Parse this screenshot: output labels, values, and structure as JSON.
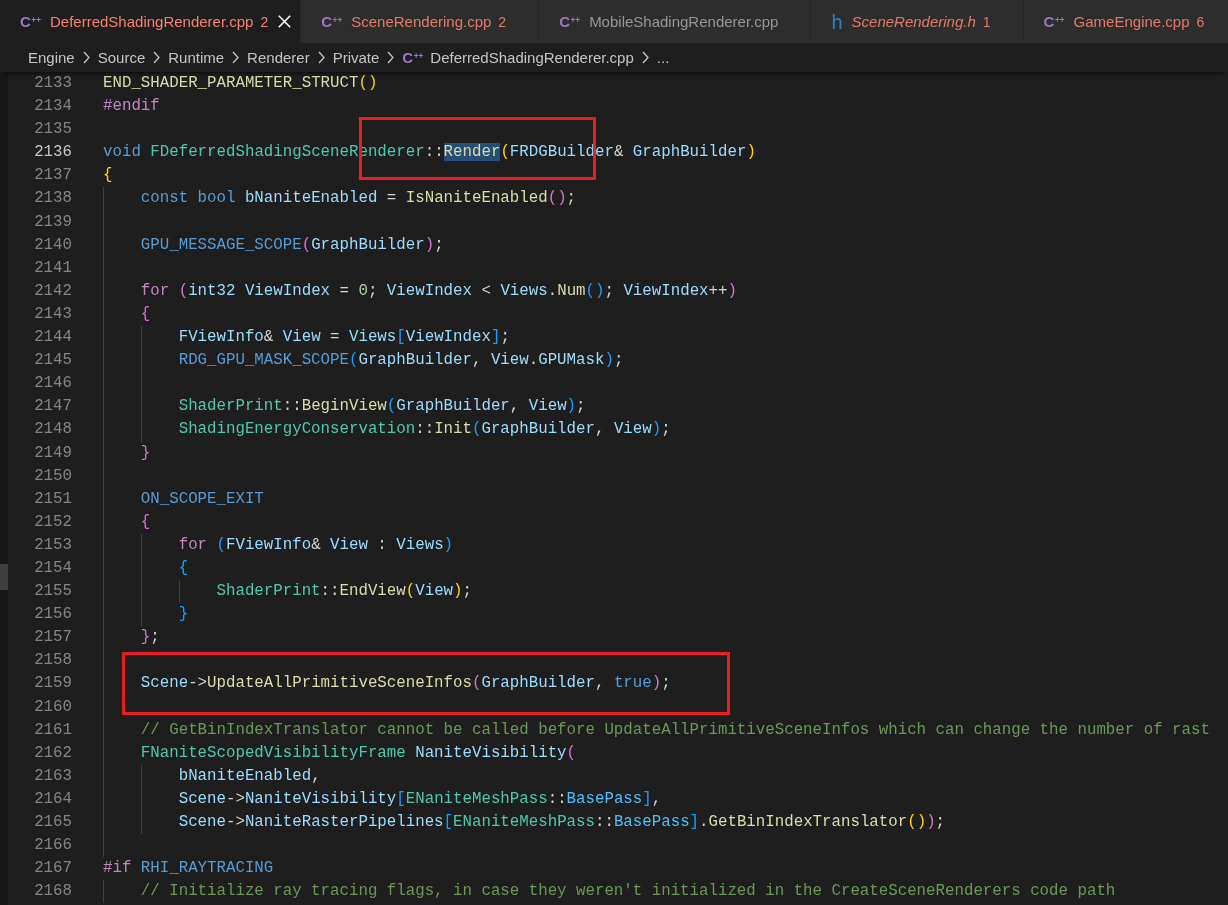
{
  "tabs": [
    {
      "icon": {
        "kind": "cpp",
        "glyph": "C$^{++}$"
      },
      "label": "DeferredShadingRenderer.cpp",
      "problems": "2",
      "selected": true,
      "preview": false
    },
    {
      "icon": {
        "kind": "cpp",
        "glyph": "C$^{++}$"
      },
      "label": "SceneRendering.cpp",
      "problems": "2",
      "selected": false,
      "preview": false
    },
    {
      "icon": {
        "kind": "cpp",
        "glyph": "C$^{++}$"
      },
      "label": "MobileShadingRenderer.cpp",
      "selected": false,
      "preview": false
    },
    {
      "icon": {
        "kind": "h",
        "glyph": "h"
      },
      "label": "SceneRendering.h",
      "problems": "1",
      "selected": false,
      "preview": true
    },
    {
      "icon": {
        "kind": "cpp",
        "glyph": "C$^{++}$"
      },
      "label": "GameEngine.cpp",
      "problems": "6",
      "selected": false,
      "preview": false
    }
  ],
  "breadcrumb": [
    {
      "label": "Engine"
    },
    {
      "label": "Source"
    },
    {
      "label": "Runtime"
    },
    {
      "label": "Renderer"
    },
    {
      "label": "Private"
    },
    {
      "icon": {
        "kind": "cpp",
        "glyph": "C$^{++}$"
      },
      "label": "DeferredShadingRenderer.cpp"
    },
    {
      "label": "..."
    }
  ],
  "editor": {
    "lines": [
      {
        "number": "2133",
        "current": false,
        "tokens": [
          {
            "kind": "function",
            "text": "END_SHADER_PARAMETER_STRUCT"
          },
          {
            "kind": "bracket1",
            "text": "()"
          }
        ]
      },
      {
        "number": "2134",
        "current": false,
        "tokens": [
          {
            "kind": "control",
            "text": "#endif"
          }
        ]
      },
      {
        "number": "2135",
        "current": false
      },
      {
        "number": "2136",
        "current": true,
        "tokens": [
          {
            "kind": "keyword",
            "text": "void "
          },
          {
            "kind": "type",
            "text": "FDeferredShadingSceneRenderer"
          },
          {
            "kind": "plain",
            "text": "::"
          },
          {
            "kind": "function",
            "text": "Render",
            "highlighted": true
          },
          {
            "kind": "bracket1",
            "text": "("
          },
          {
            "kind": "alias",
            "text": "FRDGBuilder"
          },
          {
            "kind": "plain",
            "text": "& "
          },
          {
            "kind": "variable",
            "text": "GraphBuilder"
          },
          {
            "kind": "bracket1",
            "text": ")"
          }
        ]
      },
      {
        "number": "2137",
        "current": false,
        "tokens": [
          {
            "kind": "bracket1",
            "text": "{"
          }
        ]
      },
      {
        "number": "2138",
        "current": false,
        "tokens": [
          {
            "kind": "keyword",
            "text": "    const bool "
          },
          {
            "kind": "variable",
            "text": "bNaniteEnabled"
          },
          {
            "kind": "plain",
            "text": " = "
          },
          {
            "kind": "function",
            "text": "IsNaniteEnabled"
          },
          {
            "kind": "bracket2",
            "text": "()"
          },
          {
            "kind": "plain",
            "text": ";"
          }
        ]
      },
      {
        "number": "2139",
        "current": false
      },
      {
        "number": "2140",
        "current": false,
        "tokens": [
          {
            "kind": "macro",
            "text": "    GPU_MESSAGE_SCOPE"
          },
          {
            "kind": "bracket2",
            "text": "("
          },
          {
            "kind": "variable",
            "text": "GraphBuilder"
          },
          {
            "kind": "bracket2",
            "text": ")"
          },
          {
            "kind": "plain",
            "text": ";"
          }
        ]
      },
      {
        "number": "2141",
        "current": false
      },
      {
        "number": "2142",
        "current": false,
        "tokens": [
          {
            "kind": "control",
            "text": "    for "
          },
          {
            "kind": "bracket2",
            "text": "("
          },
          {
            "kind": "alias",
            "text": "int32 "
          },
          {
            "kind": "variable",
            "text": "ViewIndex"
          },
          {
            "kind": "plain",
            "text": " = "
          },
          {
            "kind": "number",
            "text": "0"
          },
          {
            "kind": "plain",
            "text": "; "
          },
          {
            "kind": "variable",
            "text": "ViewIndex"
          },
          {
            "kind": "plain",
            "text": " < "
          },
          {
            "kind": "variable",
            "text": "Views"
          },
          {
            "kind": "plain",
            "text": "."
          },
          {
            "kind": "function",
            "text": "Num"
          },
          {
            "kind": "bracket3",
            "text": "()"
          },
          {
            "kind": "plain",
            "text": "; "
          },
          {
            "kind": "variable",
            "text": "ViewIndex"
          },
          {
            "kind": "plain",
            "text": "++"
          },
          {
            "kind": "bracket2",
            "text": ")"
          }
        ]
      },
      {
        "number": "2143",
        "current": false,
        "tokens": [
          {
            "kind": "bracket2",
            "text": "    {"
          }
        ]
      },
      {
        "number": "2144",
        "current": false,
        "tokens": [
          {
            "kind": "alias",
            "text": "        FViewInfo"
          },
          {
            "kind": "plain",
            "text": "& "
          },
          {
            "kind": "variable",
            "text": "View"
          },
          {
            "kind": "plain",
            "text": " = "
          },
          {
            "kind": "variable",
            "text": "Views"
          },
          {
            "kind": "bracket3",
            "text": "["
          },
          {
            "kind": "variable",
            "text": "ViewIndex"
          },
          {
            "kind": "bracket3",
            "text": "]"
          },
          {
            "kind": "plain",
            "text": ";"
          }
        ]
      },
      {
        "number": "2145",
        "current": false,
        "tokens": [
          {
            "kind": "macro",
            "text": "        RDG_GPU_MASK_SCOPE"
          },
          {
            "kind": "bracket3",
            "text": "("
          },
          {
            "kind": "variable",
            "text": "GraphBuilder"
          },
          {
            "kind": "plain",
            "text": ", "
          },
          {
            "kind": "variable",
            "text": "View"
          },
          {
            "kind": "plain",
            "text": "."
          },
          {
            "kind": "variable",
            "text": "GPUMask"
          },
          {
            "kind": "bracket3",
            "text": ")"
          },
          {
            "kind": "plain",
            "text": ";"
          }
        ]
      },
      {
        "number": "2146",
        "current": false
      },
      {
        "number": "2147",
        "current": false,
        "tokens": [
          {
            "kind": "type",
            "text": "        ShaderPrint"
          },
          {
            "kind": "plain",
            "text": "::"
          },
          {
            "kind": "function",
            "text": "BeginView"
          },
          {
            "kind": "bracket3",
            "text": "("
          },
          {
            "kind": "variable",
            "text": "GraphBuilder"
          },
          {
            "kind": "plain",
            "text": ", "
          },
          {
            "kind": "variable",
            "text": "View"
          },
          {
            "kind": "bracket3",
            "text": ")"
          },
          {
            "kind": "plain",
            "text": ";"
          }
        ]
      },
      {
        "number": "2148",
        "current": false,
        "tokens": [
          {
            "kind": "type",
            "text": "        ShadingEnergyConservation"
          },
          {
            "kind": "plain",
            "text": "::"
          },
          {
            "kind": "function",
            "text": "Init"
          },
          {
            "kind": "bracket3",
            "text": "("
          },
          {
            "kind": "variable",
            "text": "GraphBuilder"
          },
          {
            "kind": "plain",
            "text": ", "
          },
          {
            "kind": "variable",
            "text": "View"
          },
          {
            "kind": "bracket3",
            "text": ")"
          },
          {
            "kind": "plain",
            "text": ";"
          }
        ]
      },
      {
        "number": "2149",
        "current": false,
        "tokens": [
          {
            "kind": "bracket2",
            "text": "    }"
          }
        ]
      },
      {
        "number": "2150",
        "current": false
      },
      {
        "number": "2151",
        "current": false,
        "tokens": [
          {
            "kind": "macro",
            "text": "    ON_SCOPE_EXIT"
          }
        ]
      },
      {
        "number": "2152",
        "current": false,
        "tokens": [
          {
            "kind": "bracket2",
            "text": "    {"
          }
        ]
      },
      {
        "number": "2153",
        "current": false,
        "tokens": [
          {
            "kind": "control",
            "text": "        for "
          },
          {
            "kind": "bracket3",
            "text": "("
          },
          {
            "kind": "alias",
            "text": "FViewInfo"
          },
          {
            "kind": "plain",
            "text": "& "
          },
          {
            "kind": "variable",
            "text": "View"
          },
          {
            "kind": "plain",
            "text": " : "
          },
          {
            "kind": "variable",
            "text": "Views"
          },
          {
            "kind": "bracket3",
            "text": ")"
          }
        ]
      },
      {
        "number": "2154",
        "current": false,
        "tokens": [
          {
            "kind": "bracket3",
            "text": "        {"
          }
        ]
      },
      {
        "number": "2155",
        "current": false,
        "tokens": [
          {
            "kind": "type",
            "text": "            ShaderPrint"
          },
          {
            "kind": "plain",
            "text": "::"
          },
          {
            "kind": "function",
            "text": "EndView"
          },
          {
            "kind": "bracket1",
            "text": "("
          },
          {
            "kind": "variable",
            "text": "View"
          },
          {
            "kind": "bracket1",
            "text": ")"
          },
          {
            "kind": "plain",
            "text": ";"
          }
        ]
      },
      {
        "number": "2156",
        "current": false,
        "tokens": [
          {
            "kind": "bracket3",
            "text": "        }"
          }
        ]
      },
      {
        "number": "2157",
        "current": false,
        "tokens": [
          {
            "kind": "bracket2",
            "text": "    }"
          },
          {
            "kind": "plain",
            "text": ";"
          }
        ]
      },
      {
        "number": "2158",
        "current": false
      },
      {
        "number": "2159",
        "current": false,
        "tokens": [
          {
            "kind": "variable",
            "text": "    Scene"
          },
          {
            "kind": "plain",
            "text": "->"
          },
          {
            "kind": "function",
            "text": "UpdateAllPrimitiveSceneInfos"
          },
          {
            "kind": "bracket2",
            "text": "("
          },
          {
            "kind": "variable",
            "text": "GraphBuilder"
          },
          {
            "kind": "plain",
            "text": ", "
          },
          {
            "kind": "keyword",
            "text": "true"
          },
          {
            "kind": "bracket2",
            "text": ")"
          },
          {
            "kind": "plain",
            "text": ";"
          }
        ]
      },
      {
        "number": "2160",
        "current": false
      },
      {
        "number": "2161",
        "current": false,
        "tokens": [
          {
            "kind": "comment",
            "text": "    // GetBinIndexTranslator cannot be called before UpdateAllPrimitiveSceneInfos which can change the number of rast"
          }
        ]
      },
      {
        "number": "2162",
        "current": false,
        "tokens": [
          {
            "kind": "type",
            "text": "    FNaniteScopedVisibilityFrame "
          },
          {
            "kind": "variable",
            "text": "NaniteVisibility"
          },
          {
            "kind": "bracket2",
            "text": "("
          }
        ]
      },
      {
        "number": "2163",
        "current": false,
        "tokens": [
          {
            "kind": "variable",
            "text": "        bNaniteEnabled"
          },
          {
            "kind": "plain",
            "text": ","
          }
        ]
      },
      {
        "number": "2164",
        "current": false,
        "tokens": [
          {
            "kind": "variable",
            "text": "        Scene"
          },
          {
            "kind": "plain",
            "text": "->"
          },
          {
            "kind": "variable",
            "text": "NaniteVisibility"
          },
          {
            "kind": "bracket3",
            "text": "["
          },
          {
            "kind": "type",
            "text": "ENaniteMeshPass"
          },
          {
            "kind": "plain",
            "text": "::"
          },
          {
            "kind": "enum",
            "text": "BasePass"
          },
          {
            "kind": "bracket3",
            "text": "]"
          },
          {
            "kind": "plain",
            "text": ","
          }
        ]
      },
      {
        "number": "2165",
        "current": false,
        "tokens": [
          {
            "kind": "variable",
            "text": "        Scene"
          },
          {
            "kind": "plain",
            "text": "->"
          },
          {
            "kind": "variable",
            "text": "NaniteRasterPipelines"
          },
          {
            "kind": "bracket3",
            "text": "["
          },
          {
            "kind": "type",
            "text": "ENaniteMeshPass"
          },
          {
            "kind": "plain",
            "text": "::"
          },
          {
            "kind": "enum",
            "text": "BasePass"
          },
          {
            "kind": "bracket3",
            "text": "]"
          },
          {
            "kind": "plain",
            "text": "."
          },
          {
            "kind": "function",
            "text": "GetBinIndexTranslator"
          },
          {
            "kind": "bracket1",
            "text": "()"
          },
          {
            "kind": "bracket2",
            "text": ")"
          },
          {
            "kind": "plain",
            "text": ";"
          }
        ]
      },
      {
        "number": "2166",
        "current": false
      },
      {
        "number": "2167",
        "current": false,
        "tokens": [
          {
            "kind": "control",
            "text": "#if "
          },
          {
            "kind": "macro",
            "text": "RHI_RAYTRACING"
          }
        ]
      },
      {
        "number": "2168",
        "current": false,
        "tokens": [
          {
            "kind": "comment",
            "text": "    // Initialize ray tracing flags, in case they weren't initialized in the CreateSceneRenderers code path"
          }
        ]
      }
    ],
    "annotations": [
      {
        "kind": "rectangle"
      },
      {
        "kind": "rectangle"
      }
    ]
  }
}
